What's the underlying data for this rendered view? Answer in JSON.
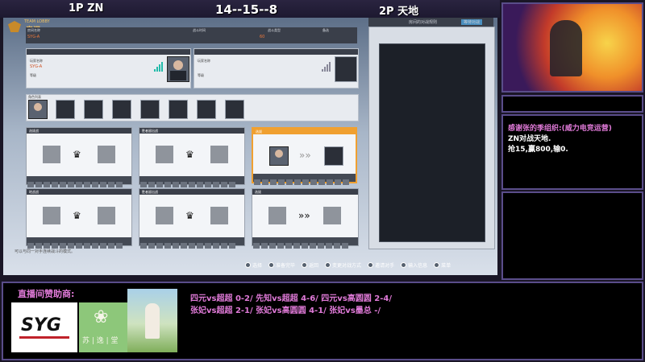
{
  "top": {
    "p1": "1P ZN",
    "score": "14--15--8",
    "p2": "2P 天地"
  },
  "game": {
    "logo_small": "TEAM LOBBY",
    "room_title": "房间",
    "info_labels": [
      "房间名称",
      "战斗时间",
      "战斗类型",
      "备选"
    ],
    "info_values": [
      "SYG-A",
      "60",
      "",
      ""
    ],
    "p1_header": "玩家信息",
    "p1_name": "SYG-A",
    "p1_name_label": "玩家名称",
    "p1_sub": "等级",
    "p2_header": "玩家信息",
    "p2_name_label": "玩家名称",
    "p2_sub": "等级",
    "roster_label": "角色列表",
    "modes": [
      {
        "title": "选拔战",
        "tag": "1P 3",
        "tag2": "2P 3"
      },
      {
        "title": "胜者留出战",
        "tag": "1P 3",
        "tag2": "2P 3"
      },
      {
        "title": "选拔",
        "tag": "1P 1",
        "tag2": "2P 1"
      },
      {
        "title": "地战战",
        "tag": "1P 3",
        "tag2": "2P 3"
      },
      {
        "title": "胜者留出战",
        "tag": "1P 3",
        "tag2": "2P 3"
      },
      {
        "title": "选拔",
        "tag": "1P 1",
        "tag2": "2P 1"
      }
    ],
    "right_tabs": [
      "房间的对战规则",
      "等待对战"
    ],
    "hint_text": "可以与同一对手连续战斗的模式。",
    "buttons": [
      "选择",
      "准备完毕",
      "返回",
      "变更对战方式",
      "邀请对手",
      "输入信息",
      "菜单"
    ]
  },
  "right": {
    "announce_lines": [
      "感谢张的季组织:(威力电竞运营)",
      "ZN对战天地.",
      "抢15,赢800,输0."
    ]
  },
  "bottom": {
    "sponsor_label": "直播间赞助商:",
    "sponsor_logo_text": "SYG",
    "sponsor2_text": "苏 | 逸 | 堂",
    "results_line1": "四元vs超超 0-2/ 先知vs超超 4-6/ 四元vs高圆圆 2-4/",
    "results_line2": "张妃vs超超 2-1/ 张妃vs高圆圆 4-1/ 张妃vs墨总 -/"
  },
  "colors": {
    "accent_purple": "#5a4d8a",
    "announce_pink": "#e07ad8",
    "selected_orange": "#f0a030"
  }
}
